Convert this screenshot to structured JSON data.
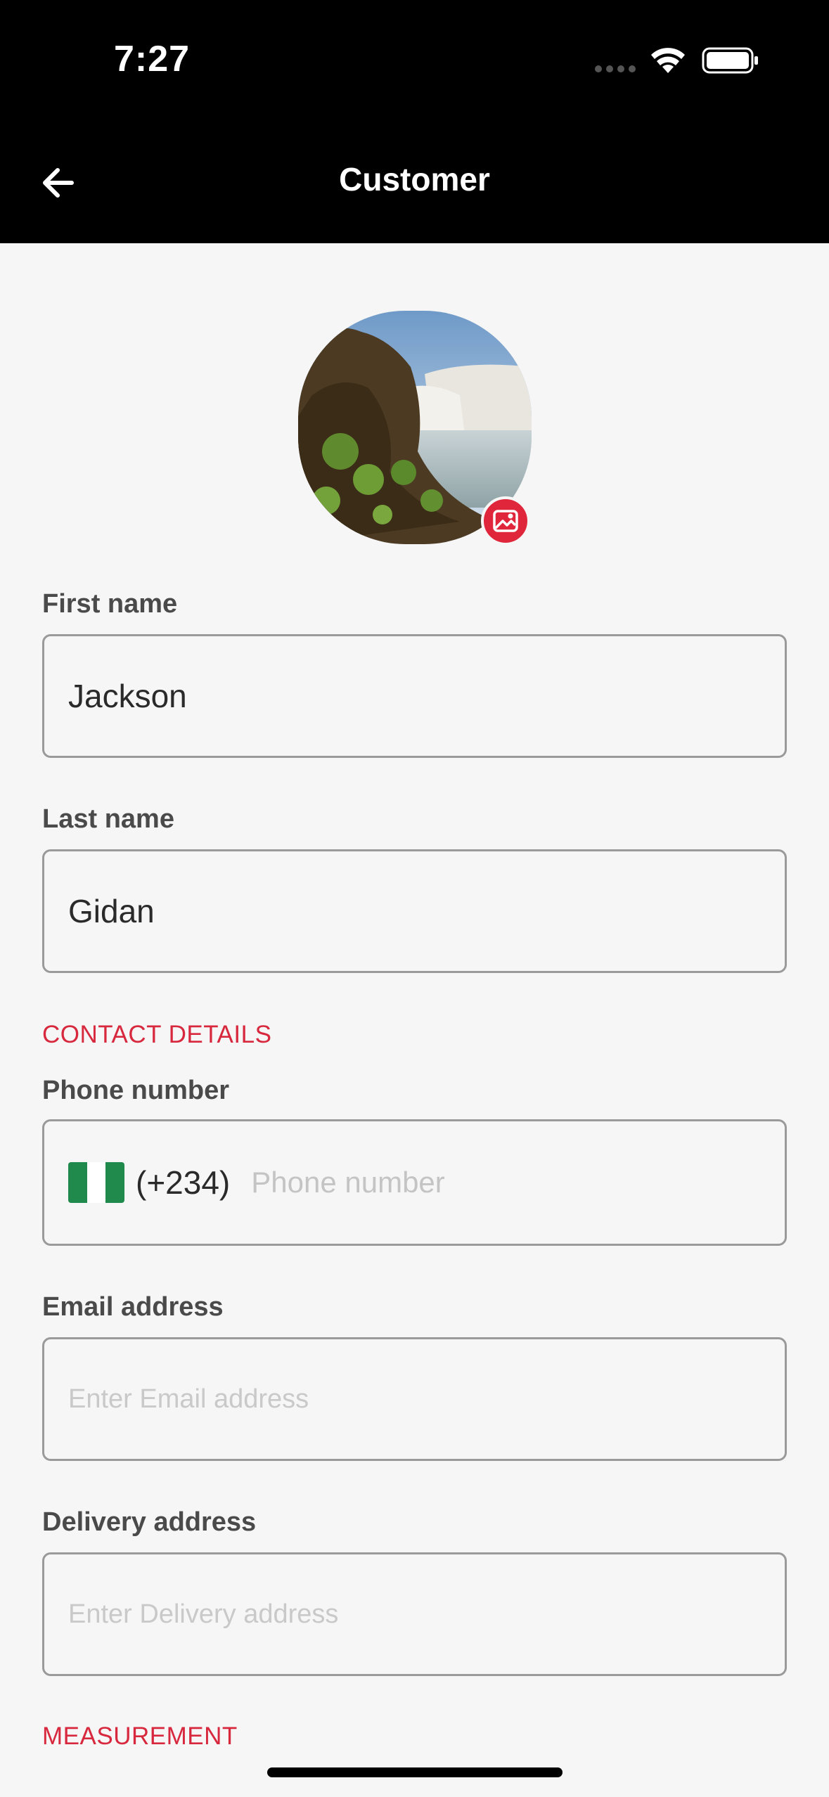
{
  "status_bar": {
    "time": "7:27"
  },
  "header": {
    "title": "Customer",
    "back_icon": "back-arrow-icon"
  },
  "avatar": {
    "edit_icon": "image-edit-icon",
    "accent": "#e0263a"
  },
  "first_name": {
    "label": "First name",
    "value": "Jackson"
  },
  "last_name": {
    "label": "Last name",
    "value": "Gidan"
  },
  "contact_section": {
    "title": "CONTACT DETAILS"
  },
  "phone": {
    "label": "Phone number",
    "dial_code": "(+234)",
    "placeholder": "Phone number",
    "flag": "nigeria-flag"
  },
  "email": {
    "label": "Email address",
    "placeholder": "Enter Email address"
  },
  "delivery": {
    "label": "Delivery address",
    "placeholder": "Enter Delivery address"
  },
  "measurement_section": {
    "title": "MEASUREMENT"
  },
  "colors": {
    "section_accent": "#d7283e",
    "header_bg": "#000000",
    "page_bg": "#f6f6f6"
  }
}
